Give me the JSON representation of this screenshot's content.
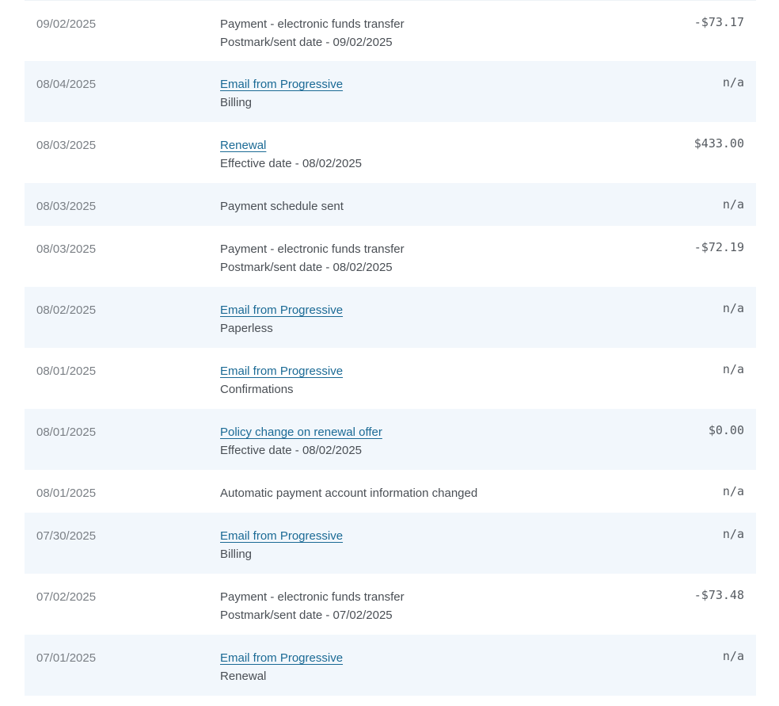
{
  "rows": [
    {
      "date": "09/02/2025",
      "title": "Payment - electronic funds transfer",
      "link": false,
      "detail": "Postmark/sent date - 09/02/2025",
      "amount": "-$73.17"
    },
    {
      "date": "08/04/2025",
      "title": "Email from Progressive",
      "link": true,
      "detail": "Billing",
      "amount": "n/a"
    },
    {
      "date": "08/03/2025",
      "title": "Renewal",
      "link": true,
      "detail": "Effective date - 08/02/2025",
      "amount": "$433.00"
    },
    {
      "date": "08/03/2025",
      "title": "Payment schedule sent",
      "link": false,
      "detail": "",
      "amount": "n/a"
    },
    {
      "date": "08/03/2025",
      "title": "Payment - electronic funds transfer",
      "link": false,
      "detail": "Postmark/sent date - 08/02/2025",
      "amount": "-$72.19"
    },
    {
      "date": "08/02/2025",
      "title": "Email from Progressive",
      "link": true,
      "detail": "Paperless",
      "amount": "n/a"
    },
    {
      "date": "08/01/2025",
      "title": "Email from Progressive",
      "link": true,
      "detail": "Confirmations",
      "amount": "n/a"
    },
    {
      "date": "08/01/2025",
      "title": "Policy change on renewal offer",
      "link": true,
      "detail": "Effective date - 08/02/2025",
      "amount": "$0.00"
    },
    {
      "date": "08/01/2025",
      "title": "Automatic payment account information changed",
      "link": false,
      "detail": "",
      "amount": "n/a"
    },
    {
      "date": "07/30/2025",
      "title": "Email from Progressive",
      "link": true,
      "detail": "Billing",
      "amount": "n/a"
    },
    {
      "date": "07/02/2025",
      "title": "Payment - electronic funds transfer",
      "link": false,
      "detail": "Postmark/sent date - 07/02/2025",
      "amount": "-$73.48"
    },
    {
      "date": "07/01/2025",
      "title": "Email from Progressive",
      "link": true,
      "detail": "Renewal",
      "amount": "n/a"
    }
  ]
}
